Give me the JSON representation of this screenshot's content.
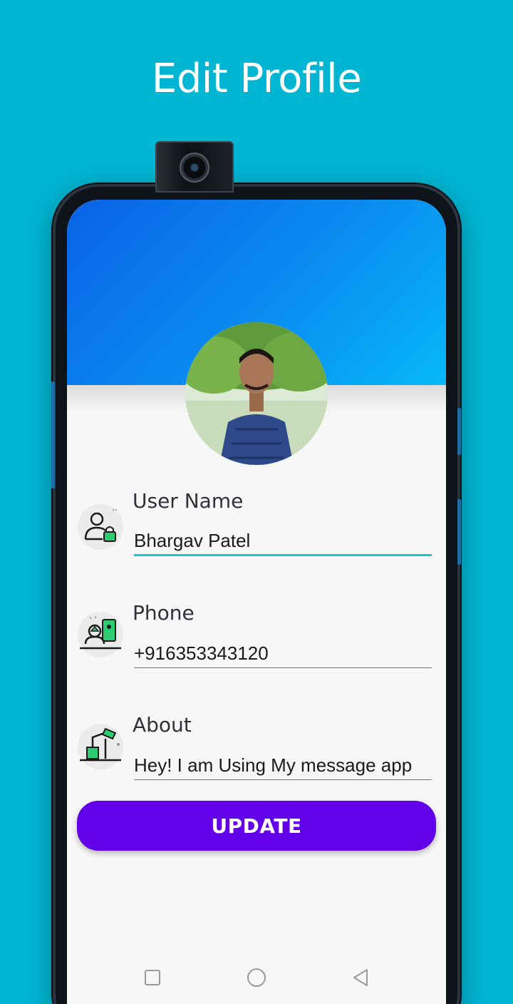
{
  "promo": {
    "title": "Edit Profile"
  },
  "profile": {
    "avatar_alt": "profile-photo"
  },
  "fields": [
    {
      "label": "User Name",
      "value": "Bhargav Patel",
      "icon": "user-lock-icon"
    },
    {
      "label": "Phone",
      "value": "+916353343120",
      "icon": "phone-contact-icon"
    },
    {
      "label": "About",
      "value": "Hey! I am Using My message app",
      "icon": "desk-lamp-icon"
    }
  ],
  "update_label": "UPDATE",
  "colors": {
    "background": "#00b6d3",
    "header_start": "#0a63e6",
    "header_end": "#07b8f7",
    "button": "#6200ea",
    "active_underline": "#19c6c9",
    "icon_accent": "#2ecc71"
  },
  "navbar": {
    "recent": "square-icon",
    "home": "circle-icon",
    "back": "triangle-back-icon"
  }
}
